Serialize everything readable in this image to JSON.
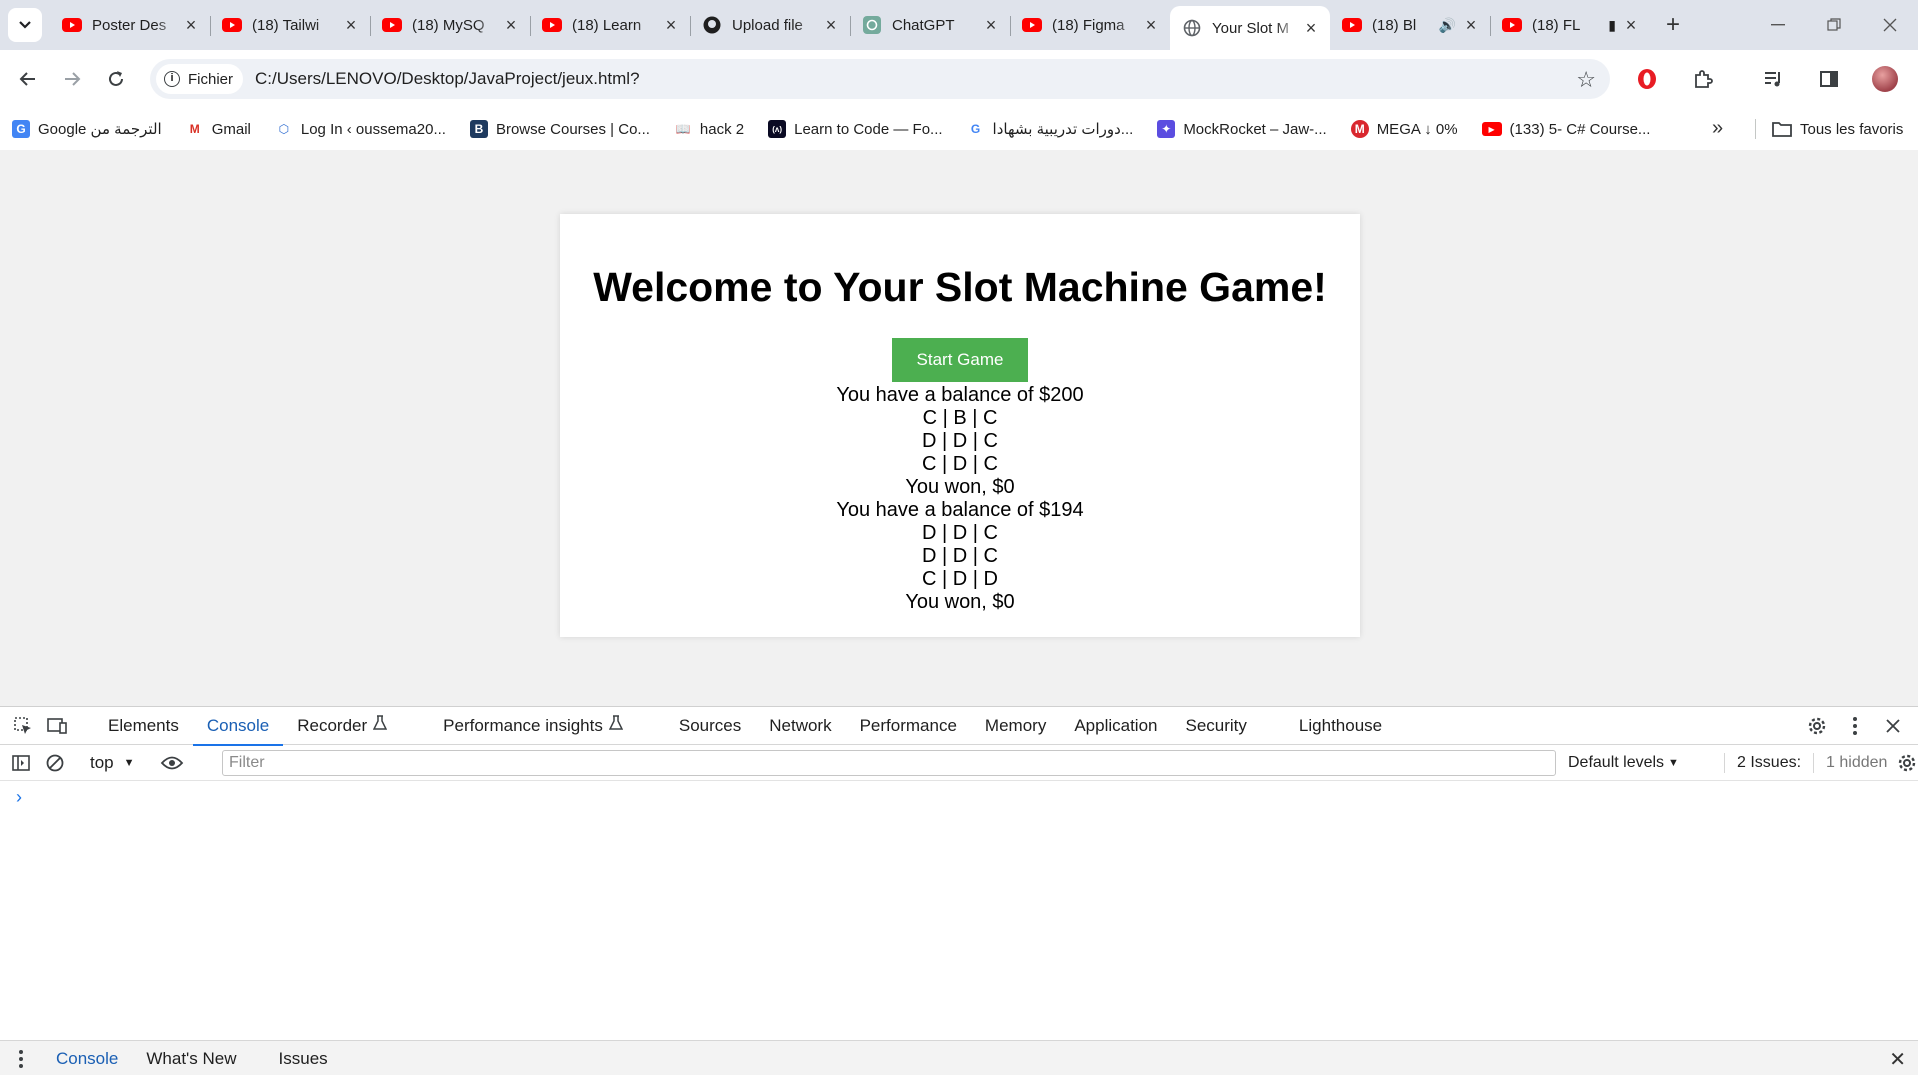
{
  "browser": {
    "tabs": [
      {
        "title": "Poster Des",
        "favicon": "youtube-icon",
        "active": false
      },
      {
        "title": "(18) Tailwi",
        "favicon": "youtube-icon",
        "active": false
      },
      {
        "title": "(18) MySQ",
        "favicon": "youtube-icon",
        "active": false
      },
      {
        "title": "(18) Learn",
        "favicon": "youtube-icon",
        "active": false
      },
      {
        "title": "Upload file",
        "favicon": "github-icon",
        "active": false
      },
      {
        "title": "ChatGPT",
        "favicon": "chatgpt-icon",
        "active": false
      },
      {
        "title": "(18) Figma",
        "favicon": "youtube-icon",
        "active": false
      },
      {
        "title": "Your Slot M",
        "favicon": "globe-icon",
        "active": true
      },
      {
        "title": "(18) Bl",
        "favicon": "youtube-icon",
        "active": false,
        "audio": true
      },
      {
        "title": "(18) FL",
        "favicon": "youtube-icon",
        "active": false,
        "media": true
      }
    ],
    "address": {
      "chip_label": "Fichier",
      "url": "C:/Users/LENOVO/Desktop/JavaProject/jeux.html?"
    },
    "bookmarks": [
      {
        "label": "Google الترجمة من",
        "icon": "google-translate-icon"
      },
      {
        "label": "Gmail",
        "icon": "gmail-icon"
      },
      {
        "label": "Log In ‹ oussema20...",
        "icon": "hex-icon"
      },
      {
        "label": "Browse Courses | Co...",
        "icon": "course-icon"
      },
      {
        "label": "hack 2",
        "icon": "book-icon"
      },
      {
        "label": "Learn to Code — Fo...",
        "icon": "freecodecamp-icon"
      },
      {
        "label": "دورات تدريبية بشهادا...",
        "icon": "google-icon"
      },
      {
        "label": "MockRocket – Jaw-...",
        "icon": "rocket-icon"
      },
      {
        "label": "MEGA ↓ 0%",
        "icon": "mega-icon"
      },
      {
        "label": "(133) 5- C# Course...",
        "icon": "youtube-icon"
      }
    ],
    "all_bookmarks_label": "Tous les favoris"
  },
  "page": {
    "heading": "Welcome to Your Slot Machine Game!",
    "start_button": "Start Game",
    "output_lines": [
      "You have a balance of $200",
      "C | B | C",
      "D | D | C",
      "C | D | C",
      "You won, $0",
      "You have a balance of $194",
      "D | D | C",
      "D | D | C",
      "C | D | D",
      "You won, $0"
    ],
    "button_color": "#4caf50"
  },
  "devtools": {
    "tabs": [
      "Elements",
      "Console",
      "Recorder",
      "Performance insights",
      "Sources",
      "Network",
      "Performance",
      "Memory",
      "Application",
      "Security",
      "Lighthouse"
    ],
    "active_tab": "Console",
    "context": "top",
    "filter_placeholder": "Filter",
    "levels": "Default levels",
    "issues": "2 Issues:",
    "hidden": "1 hidden",
    "drawer_tabs": [
      "Console",
      "What's New",
      "Issues"
    ]
  }
}
